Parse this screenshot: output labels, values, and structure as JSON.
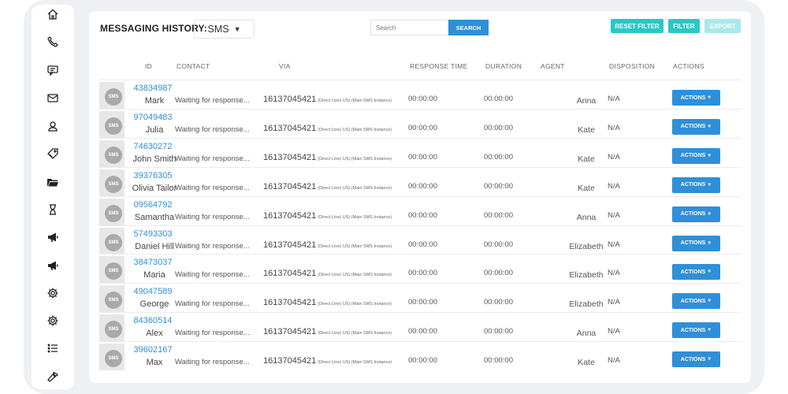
{
  "header": {
    "title": "MESSAGING HISTORY:",
    "channel_select": "SMS",
    "search_placeholder": "Search",
    "search_button": "SEARCH",
    "reset_filter": "RESET FILTER",
    "filter": "FILTER",
    "export": "EXPORT"
  },
  "columns": {
    "id": "ID",
    "contact": "CONTACT",
    "via": "VIA",
    "response_time": "RESPONSE TIME",
    "duration": "DURATION",
    "agent": "AGENT",
    "disposition": "DISPOSITION",
    "actions": "ACTIONS"
  },
  "sidebar_icons": [
    "home-icon",
    "phone-icon",
    "chat-icon",
    "mail-icon",
    "user-icon",
    "tag-icon",
    "folder-icon",
    "hourglass-icon",
    "megaphone-icon",
    "megaphone-icon",
    "gear-icon",
    "gear-icon",
    "list-icon",
    "wrench-icon"
  ],
  "rows": [
    {
      "avatar": "SMS",
      "id": "43834987",
      "name": "Mark",
      "status": "Waiting for response...",
      "phone": "16137045421",
      "instance": "(Direct Line) US) (Main SMS Instance)",
      "response_time": "00:00:00",
      "duration": "00:00:00",
      "agent": "Anna",
      "disposition": "N/A",
      "action": "ACTIONS"
    },
    {
      "avatar": "SMS",
      "id": "97049483",
      "name": "Julia",
      "status": "Waiting for response...",
      "phone": "16137045421",
      "instance": "(Direct Line) US) (Main SMS Instance)",
      "response_time": "00:00:00",
      "duration": "00:00:00",
      "agent": "Kate",
      "disposition": "N/A",
      "action": "ACTIONS"
    },
    {
      "avatar": "SMS",
      "id": "74630272",
      "name": "John Smith",
      "status": "Waiting for response...",
      "phone": "16137045421",
      "instance": "(Direct Line) US) (Main SMS Instance)",
      "response_time": "00:00:00",
      "duration": "00:00:00",
      "agent": "Kate",
      "disposition": "N/A",
      "action": "ACTIONS"
    },
    {
      "avatar": "SMS",
      "id": "39376305",
      "name": "Olivia Tailor",
      "status": "Waiting for response...",
      "phone": "16137045421",
      "instance": "(Direct Line) US) (Main SMS Instance)",
      "response_time": "00:00:00",
      "duration": "00:00:00",
      "agent": "Kate",
      "disposition": "N/A",
      "action": "ACTIONS"
    },
    {
      "avatar": "SMS",
      "id": "09564792",
      "name": "Samantha",
      "status": "Waiting for response...",
      "phone": "16137045421",
      "instance": "(Direct Line) US) (Main SMS Instance)",
      "response_time": "00:00:00",
      "duration": "00:00:00",
      "agent": "Anna",
      "disposition": "N/A",
      "action": "ACTIONS"
    },
    {
      "avatar": "SMS",
      "id": "57493303",
      "name": "Daniel Hill",
      "status": "Waiting for response...",
      "phone": "16137045421",
      "instance": "(Direct Line) US) (Main SMS Instance)",
      "response_time": "00:00:00",
      "duration": "00:00:00",
      "agent": "Elizabeth",
      "disposition": "N/A",
      "action": "ACTIONS"
    },
    {
      "avatar": "SMS",
      "id": "38473037",
      "name": "Maria",
      "status": "Waiting for response...",
      "phone": "16137045421",
      "instance": "(Direct Line) US) (Main SMS Instance)",
      "response_time": "00:00:00",
      "duration": "00:00:00",
      "agent": "Elizabeth",
      "disposition": "N/A",
      "action": "ACTIONS"
    },
    {
      "avatar": "SMS",
      "id": "49047589",
      "name": "George",
      "status": "Waiting for response...",
      "phone": "16137045421",
      "instance": "(Direct Line) US) (Main SMS Instance)",
      "response_time": "00:00:00",
      "duration": "00:00:00",
      "agent": "Elizabeth",
      "disposition": "N/A",
      "action": "ACTIONS"
    },
    {
      "avatar": "SMS",
      "id": "84360514",
      "name": "Alex",
      "status": "Waiting for response...",
      "phone": "16137045421",
      "instance": "(Direct Line) US) (Main SMS Instance)",
      "response_time": "00:00:00",
      "duration": "00:00:00",
      "agent": "Anna",
      "disposition": "N/A",
      "action": "ACTIONS"
    },
    {
      "avatar": "SMS",
      "id": "39602167",
      "name": "Max",
      "status": "Waiting for response...",
      "phone": "16137045421",
      "instance": "(Direct Line) US) (Main SMS Instance)",
      "response_time": "00:00:00",
      "duration": "00:00:00",
      "agent": "Kate",
      "disposition": "N/A",
      "action": "ACTIONS"
    }
  ]
}
